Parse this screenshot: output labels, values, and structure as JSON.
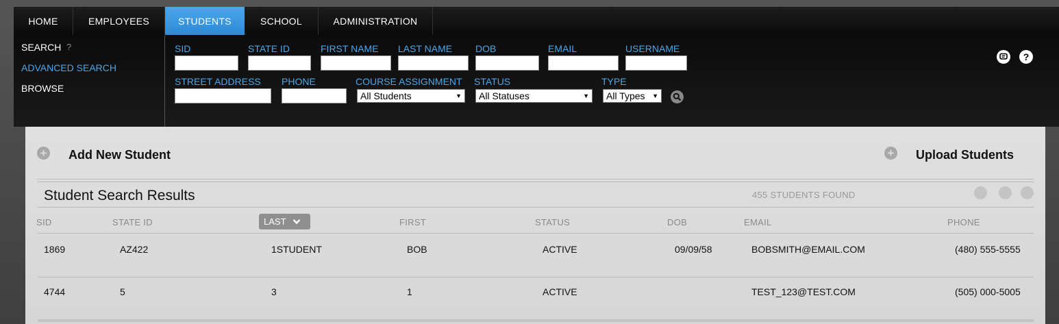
{
  "nav": {
    "tabs": [
      {
        "label": "HOME"
      },
      {
        "label": "EMPLOYEES"
      },
      {
        "label": "STUDENTS"
      },
      {
        "label": "SCHOOL"
      },
      {
        "label": "ADMINISTRATION"
      }
    ],
    "active_tab": "STUDENTS"
  },
  "sidebar": {
    "items": [
      {
        "label": "SEARCH"
      },
      {
        "label": "ADVANCED SEARCH"
      },
      {
        "label": "BROWSE"
      }
    ],
    "help_mark": "?"
  },
  "search": {
    "sid_label": "SID",
    "state_id_label": "STATE ID",
    "first_name_label": "FIRST NAME",
    "last_name_label": "LAST NAME",
    "dob_label": "DOB",
    "email_label": "EMAIL",
    "username_label": "USERNAME",
    "street_label": "STREET ADDRESS",
    "phone_label": "PHONE",
    "course_label": "COURSE ASSIGNMENT",
    "course_value": "All Students",
    "status_label": "STATUS",
    "status_value": "All Statuses",
    "type_label": "TYPE",
    "type_value": "All Types"
  },
  "header_icons": {
    "help": "?"
  },
  "actions": {
    "add_student": "Add New Student",
    "upload_students": "Upload Students"
  },
  "results": {
    "title": "Student Search Results",
    "count_text": "455 STUDENTS FOUND",
    "columns": [
      "SID",
      "STATE ID",
      "LAST",
      "FIRST",
      "STATUS",
      "DOB",
      "EMAIL",
      "PHONE"
    ],
    "rows": [
      {
        "sid": "1869",
        "state_id": "AZ422",
        "last": "1STUDENT",
        "first": "BOB",
        "status": "ACTIVE",
        "dob": "09/09/58",
        "email": "BOBSMITH@EMAIL.COM",
        "phone": "(480) 555-5555"
      },
      {
        "sid": "4744",
        "state_id": "5",
        "last": "3",
        "first": "1",
        "status": "ACTIVE",
        "dob": "",
        "email": "TEST_123@TEST.COM",
        "phone": "(505) 000-5005"
      }
    ]
  },
  "colors": {
    "accent": "#4aa6ea",
    "nav_bg": "#0a0a0a",
    "content_bg": "#dcdcdc"
  }
}
